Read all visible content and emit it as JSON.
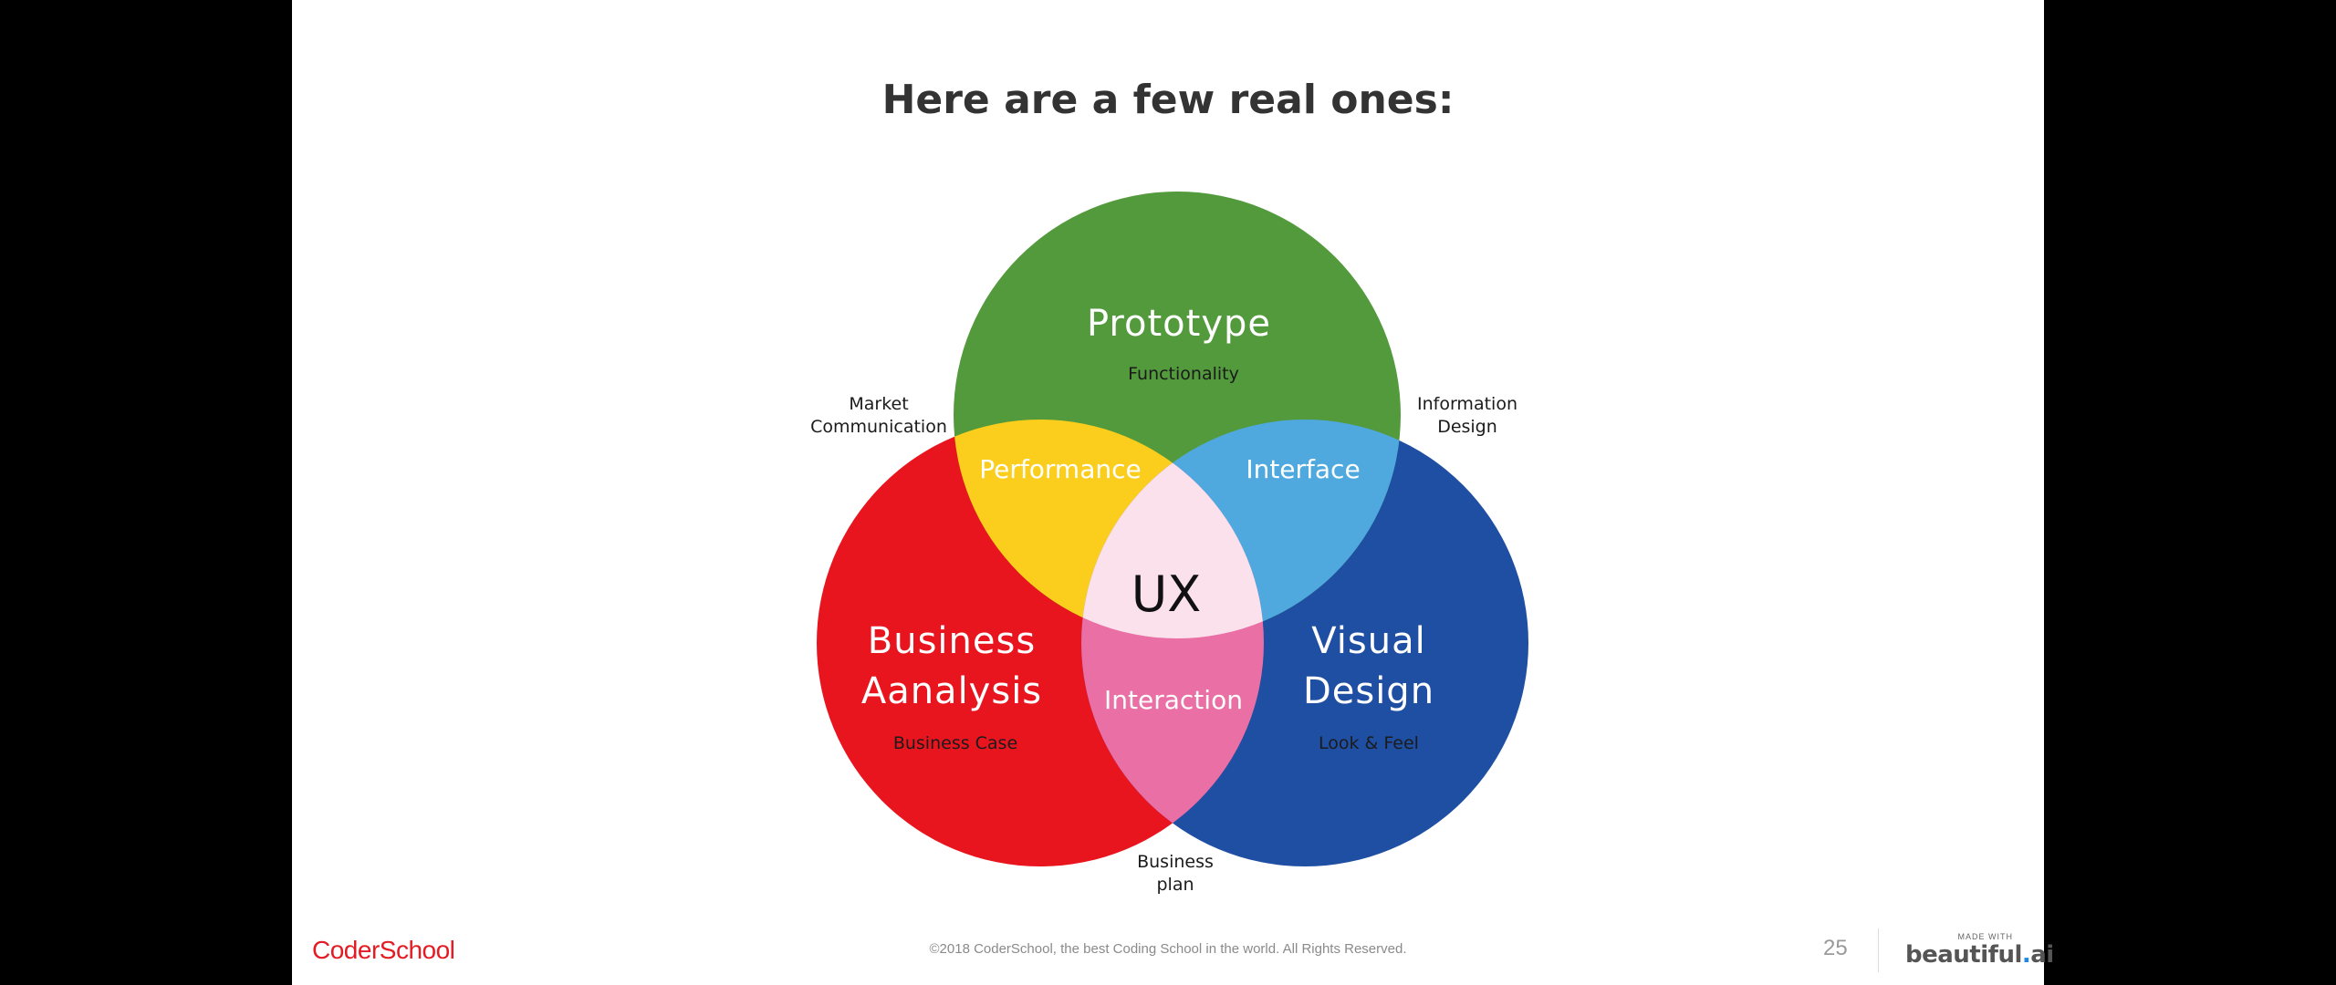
{
  "slide": {
    "title": "Here are a few real ones:",
    "page_number": "25"
  },
  "venn": {
    "center": "UX",
    "circles": {
      "top": {
        "title": "Prototype",
        "subtitle": "Functionality",
        "color": "#529a3c"
      },
      "left": {
        "title_line1": "Business",
        "title_line2": "Aanalysis",
        "subtitle": "Business Case",
        "color": "#e8151f"
      },
      "right": {
        "title_line1": "Visual",
        "title_line2": "Design",
        "subtitle": "Look & Feel",
        "color": "#1f4fa3"
      }
    },
    "overlaps": {
      "top_left": {
        "label": "Performance",
        "color": "#fbcd1c"
      },
      "top_right": {
        "label": "Interface",
        "color": "#4fa8de"
      },
      "left_right": {
        "label": "Interaction",
        "color": "#ea6fa4"
      },
      "center_color": "#fbe1ec"
    },
    "outer_labels": {
      "market": {
        "line1": "Market",
        "line2": "Communication"
      },
      "information": {
        "line1": "Information",
        "line2": "Design"
      },
      "business_plan": {
        "line1": "Business",
        "line2": "plan"
      }
    }
  },
  "footer": {
    "logo": "CoderSchool",
    "copyright": "©2018 CoderSchool, the best Coding School in the world. All Rights Reserved.",
    "made_with": "MADE WITH",
    "brand_main": "beautiful",
    "brand_dot": ".",
    "brand_suffix": "ai"
  }
}
